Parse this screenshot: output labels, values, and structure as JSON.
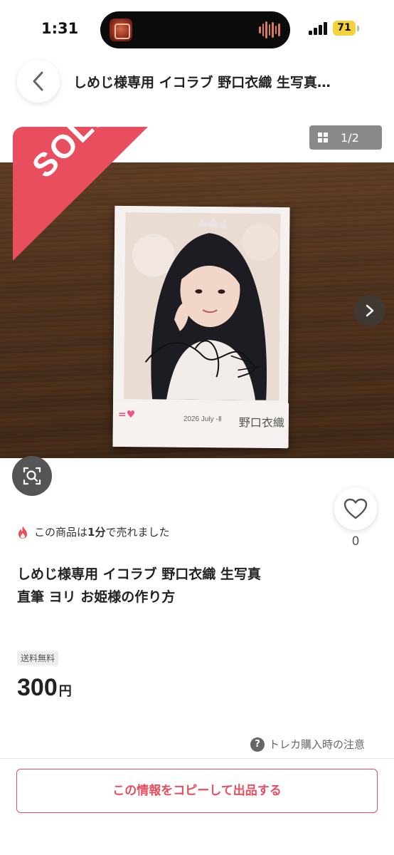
{
  "status_bar": {
    "time": "1:31",
    "battery": "71",
    "colors": {
      "battery": "#f3d23b"
    }
  },
  "header": {
    "back_icon": "chevron-left-icon",
    "title": "しめじ様専用 イコラブ 野口衣織 生写真…"
  },
  "gallery": {
    "sold_badge": "SOLD",
    "page_counter": "1/2",
    "counter_icon": "grid-icon",
    "next_icon": "chevron-right-icon",
    "zoom_icon": "image-search-icon",
    "photo_card": {
      "date_text": "2026 July -Ⅱ",
      "name_text": "野口衣織"
    },
    "colors": {
      "sold": "#e94e5f"
    }
  },
  "item": {
    "like_icon": "heart-icon",
    "like_count": "0",
    "sold_info_prefix": "この商品は",
    "sold_info_time": "1分",
    "sold_info_suffix": "で売れました",
    "title_line1": "しめじ様専用 イコラブ 野口衣織 生写真",
    "title_line2": "直筆 ヨリ お姫様の作り方",
    "shipping_badge": "送料無料",
    "price": "300",
    "price_unit": "円",
    "notice_icon": "question-circle-icon",
    "notice": "トレカ購入時の注意"
  },
  "bottom": {
    "copy_button": "この情報をコピーして出品する",
    "colors": {
      "accent": "#e94e5f"
    }
  }
}
